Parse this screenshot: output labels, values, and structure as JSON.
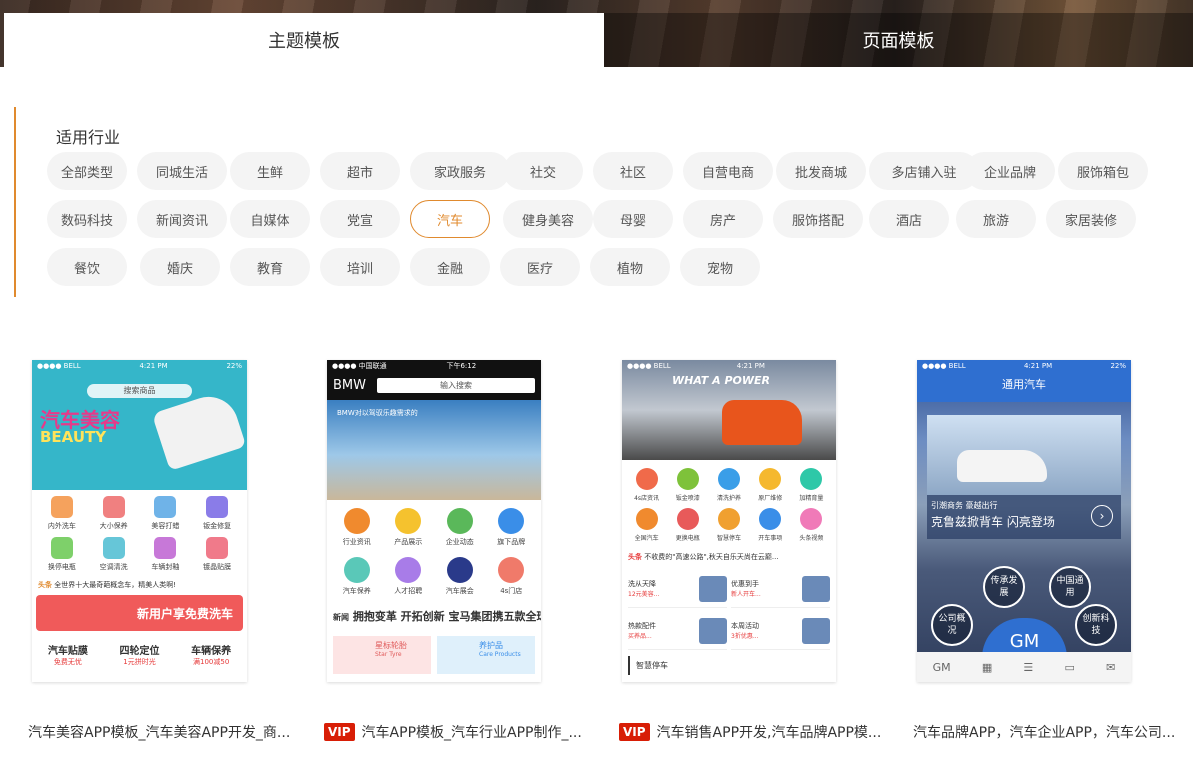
{
  "tabs": {
    "active": "主题模板",
    "inactive": "页面模板"
  },
  "filter": {
    "title": "适用行业",
    "chips": [
      "全部类型",
      "同城生活",
      "生鲜",
      "超市",
      "家政服务",
      "社交",
      "社区",
      "自营电商",
      "批发商城",
      "多店铺入驻",
      "企业品牌",
      "服饰箱包",
      "数码科技",
      "新闻资讯",
      "自媒体",
      "党宣",
      "汽车",
      "健身美容",
      "母婴",
      "房产",
      "服饰搭配",
      "酒店",
      "旅游",
      "家居装修",
      "餐饮",
      "婚庆",
      "教育",
      "培训",
      "金融",
      "医疗",
      "植物",
      "宠物"
    ],
    "active_chip": "汽车"
  },
  "cards": [
    {
      "title": "汽车美容APP模板_汽车美容APP开发_商...",
      "vip": false,
      "phone": {
        "status": [
          "●●●● BELL",
          "4:21 PM",
          "22%"
        ],
        "banner_text": "汽车美容",
        "banner_en": "BEAUTY",
        "search": "搜索商品",
        "icons": [
          "内外洗车",
          "大小保养",
          "美容打蜡",
          "钣金修复",
          "换停电瓶",
          "空调清洗",
          "车辆封釉",
          "镀晶贴膜"
        ],
        "news": "全世界十大最奇葩概念车，精美人类啊!",
        "promo": "新用户享免费洗车",
        "services": [
          {
            "name": "汽车贴膜",
            "sub": "免费无忧"
          },
          {
            "name": "四轮定位",
            "sub": "1元拼时光"
          },
          {
            "name": "车辆保养",
            "sub": "满100减50"
          }
        ]
      }
    },
    {
      "title": "汽车APP模板_汽车行业APP制作_...",
      "vip": true,
      "vip_label": "VIP",
      "phone": {
        "status": [
          "●●●● 中国联通",
          "下午6:12",
          ""
        ],
        "brand": "BMW",
        "search": "输入搜索",
        "banner_text": "BMW对以驾驭乐趣需求的",
        "icons": [
          "行业资讯",
          "产品展示",
          "企业动态",
          "旗下品牌",
          "汽车保养",
          "人才招聘",
          "汽车展会",
          "4s门店"
        ],
        "news_tag": "新闻",
        "news": "拥抱变革 开拓创新 宝马集团携五款全球",
        "products": [
          {
            "name": "星标轮胎",
            "en": "Star Tyre"
          },
          {
            "name": "养护品",
            "en": "Care Products"
          }
        ]
      }
    },
    {
      "title": "汽车销售APP开发,汽车品牌APP模...",
      "vip": true,
      "vip_label": "VIP",
      "phone": {
        "status": [
          "●●●● BELL",
          "4:21 PM",
          ""
        ],
        "banner_text": "WHAT A POWER",
        "icons": [
          "4s店资讯",
          "钣金喷漆",
          "清洗护养",
          "原厂维修",
          "加精育量",
          "全国汽车",
          "更换电瓶",
          "智慧停车",
          "开车事项",
          "头条视频"
        ],
        "news_tag": "头条",
        "news": "不收费的\"高速公路\",秋天自乐天尚在云巅...",
        "deals": [
          {
            "name": "洗从天降",
            "sub": "12元美容..."
          },
          {
            "name": "优惠到手",
            "sub": "新人开车..."
          },
          {
            "name": "热款配件",
            "sub": "买养品..."
          },
          {
            "name": "本周活动",
            "sub": "3折优惠..."
          }
        ],
        "section": "智慧停车"
      }
    },
    {
      "title": "汽车品牌APP，汽车企业APP，汽车公司...",
      "vip": false,
      "phone": {
        "status": [
          "●●●● BELL",
          "4:21 PM",
          "22%"
        ],
        "header": "通用汽车",
        "slogan_small": "引潮商务 豪越出行",
        "slogan": "克鲁兹掀背车 闪亮登场",
        "circles": [
          "传承发展",
          "中国通用",
          "公司概况",
          "创新科技"
        ],
        "logo": "GM"
      }
    }
  ]
}
